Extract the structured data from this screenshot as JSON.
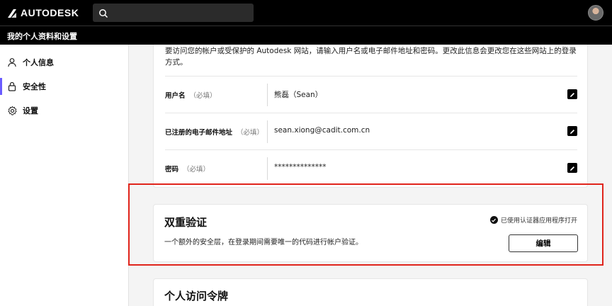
{
  "header": {
    "brand": "AUTODESK",
    "search_placeholder": ""
  },
  "subheader": {
    "title": "我的个人资料和设置"
  },
  "sidebar": {
    "items": [
      {
        "label": "个人信息",
        "icon": "person-icon"
      },
      {
        "label": "安全性",
        "icon": "lock-icon",
        "active": true
      },
      {
        "label": "设置",
        "icon": "gear-icon"
      }
    ]
  },
  "account_card": {
    "intro": "要访问您的帐户或受保护的 Autodesk 网站，请输入用户名或电子邮件地址和密码。更改此信息会更改您在这些网站上的登录方式。",
    "rows": [
      {
        "label": "用户名",
        "required": "（必填）",
        "value": "熊磊（Sean）"
      },
      {
        "label": "已注册的电子邮件地址",
        "required": "（必填）",
        "value": "sean.xiong@cadit.com.cn"
      },
      {
        "label": "密码",
        "required": "（必填）",
        "value": "**************"
      }
    ]
  },
  "two_factor": {
    "title": "双重验证",
    "description": "一个额外的安全层，在登录期间需要唯一的代码进行帐户验证。",
    "status": "已使用认证器应用程序打开",
    "edit_label": "编辑"
  },
  "personal_token": {
    "title": "个人访问令牌"
  },
  "colors": {
    "highlight": "#e0241b",
    "active_indicator": "#6a5cff",
    "topbar": "#000000"
  }
}
